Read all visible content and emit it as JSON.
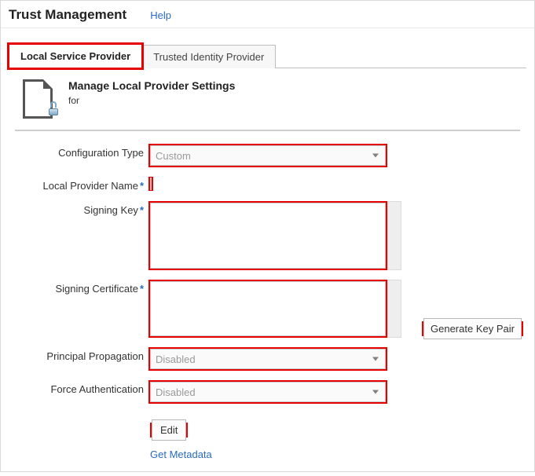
{
  "header": {
    "title": "Trust Management",
    "help_label": "Help"
  },
  "tabs": {
    "local": "Local Service Provider",
    "trusted": "Trusted Identity Provider"
  },
  "section": {
    "title": "Manage Local Provider Settings",
    "subtitle": "for"
  },
  "form": {
    "config_type": {
      "label": "Configuration Type",
      "value": "Custom"
    },
    "provider_name": {
      "label": "Local Provider Name",
      "value": ""
    },
    "signing_key": {
      "label": "Signing Key",
      "value": ""
    },
    "signing_cert": {
      "label": "Signing Certificate",
      "value": ""
    },
    "principal_prop": {
      "label": "Principal Propagation",
      "value": "Disabled"
    },
    "force_auth": {
      "label": "Force Authentication",
      "value": "Disabled"
    }
  },
  "actions": {
    "generate": "Generate Key Pair",
    "edit": "Edit",
    "get_metadata": "Get Metadata"
  }
}
